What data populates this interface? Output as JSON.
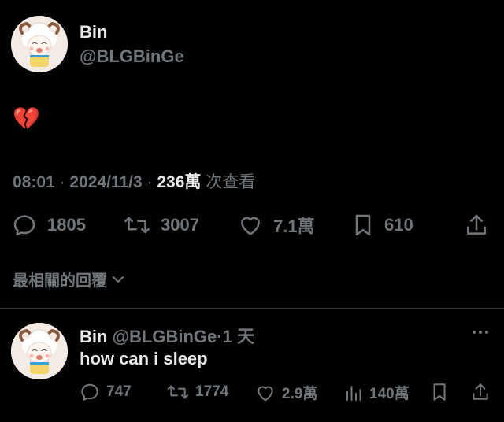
{
  "post": {
    "author_name": "Bin",
    "author_handle": "@BLGBinGe",
    "text": "💔",
    "time": "08:01",
    "date": "2024/11/3",
    "views_count": "236萬",
    "views_label": "次查看",
    "dot": "·"
  },
  "actions": {
    "replies": "1805",
    "reposts": "3007",
    "likes": "7.1萬",
    "bookmarks": "610"
  },
  "sort": {
    "label": "最相關的回覆"
  },
  "reply": {
    "author_name": "Bin",
    "author_handle": "@BLGBinGe",
    "dot": "·",
    "time": "1 天",
    "text": "how can i sleep",
    "replies": "747",
    "reposts": "1774",
    "likes": "2.9萬",
    "views": "140萬"
  },
  "colors": {
    "background": "#000000",
    "primary_text": "#e7e9ea",
    "secondary_text": "#71767b",
    "divider": "#2f3336"
  },
  "icons": {
    "reply": "speech-bubble-icon",
    "repost": "repost-arrows-icon",
    "like": "heart-outline-icon",
    "bookmark": "bookmark-icon",
    "share": "share-upload-icon",
    "views": "bar-chart-icon",
    "more": "more-dots-icon",
    "sort": "chevron-down-icon"
  }
}
